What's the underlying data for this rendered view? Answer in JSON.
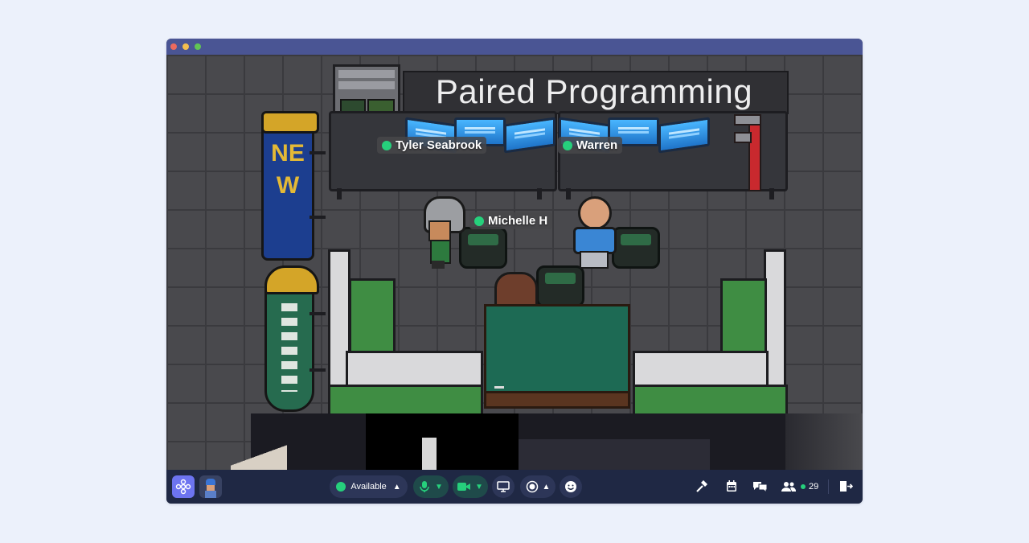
{
  "scene": {
    "room_sign": "Paired Programming",
    "left_sign_new": "NEW",
    "players": {
      "p1": "Tyler Seabrook",
      "p2": "Warren",
      "p3": "Michelle H"
    }
  },
  "toolbar": {
    "status_label": "Available",
    "participant_count": "29"
  },
  "colors": {
    "accent": "#6d74f0",
    "online": "#26d07c",
    "bar": "#1f2844",
    "titlebar": "#4a5594"
  }
}
